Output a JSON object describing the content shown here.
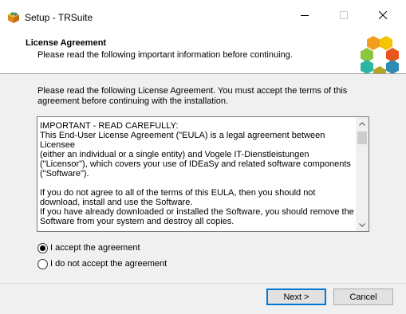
{
  "window": {
    "title": "Setup - TRSuite",
    "icon": "setup-box-icon",
    "controls": {
      "minimize": "window-minimize-icon",
      "maximize": "window-maximize-icon",
      "close": "window-close-icon"
    }
  },
  "header": {
    "title": "License Agreement",
    "subtitle": "Please read the following important information before continuing.",
    "logo": "hexagon-logo"
  },
  "main": {
    "intro": "Please read the following License Agreement. You must accept the terms of this agreement before continuing with the installation.",
    "license_text": "IMPORTANT - READ CAREFULLY:\nThis End-User License Agreement (\"EULA) is a legal agreement between Licensee\n(either an individual or a single entity) and Vogele IT-Dienstleistungen\n(\"Licensor\"), which covers your use of IDEaSy and related software components\n(\"Software\").\n\nIf you do not agree to all of the terms of this EULA, then you should not\ndownload, install and use the Software.\nIf you have already downloaded or installed the Software, you should remove the\nSoftware from your system and destroy all copies.",
    "radios": [
      {
        "label": "I accept the agreement",
        "checked": true
      },
      {
        "label": "I do not accept the agreement",
        "checked": false
      }
    ]
  },
  "footer": {
    "next_label": "Next >",
    "cancel_label": "Cancel"
  },
  "colors": {
    "hex_orange": "#f39c1f",
    "hex_yellow": "#f5c400",
    "hex_green": "#8cc63f",
    "hex_teal": "#2bb6a3",
    "hex_blue": "#2e8bb4",
    "hex_olive": "#b5a227",
    "focus_border": "#0078d7"
  }
}
